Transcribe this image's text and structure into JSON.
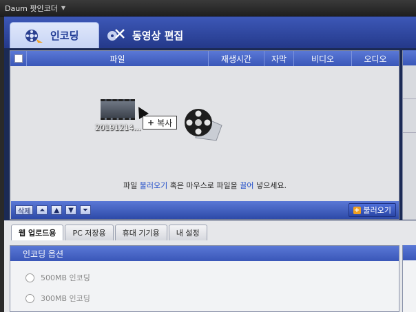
{
  "window": {
    "title": "Daum 팟인코더"
  },
  "main_tabs": [
    {
      "label": "인코딩",
      "icon": "film-reel-icon",
      "active": true
    },
    {
      "label": "동영상 편집",
      "icon": "film-edit-icon",
      "active": false
    }
  ],
  "file_table": {
    "columns": [
      "파일",
      "재생시간",
      "자막",
      "비디오",
      "오디오"
    ]
  },
  "drop_area": {
    "thumbnail_label": "20191214...",
    "copy_tooltip": "복사",
    "hint_part1": "파일 ",
    "hint_link1": "불러오기",
    "hint_part2": " 혹은 마우스로 파일을 ",
    "hint_link2": "끌어",
    "hint_part3": " 넣으세요."
  },
  "list_toolbar": {
    "delete_label": "삭제",
    "load_label": "불러오기"
  },
  "preset_tabs": [
    "웹 업로드용",
    "PC 저장용",
    "휴대 기기용",
    "내 설정"
  ],
  "options": {
    "title": "인코딩 옵션",
    "items": [
      "500MB 인코딩",
      "300MB 인코딩"
    ]
  },
  "colors": {
    "accent": "#3a57b8",
    "link": "#1f4cc8"
  }
}
